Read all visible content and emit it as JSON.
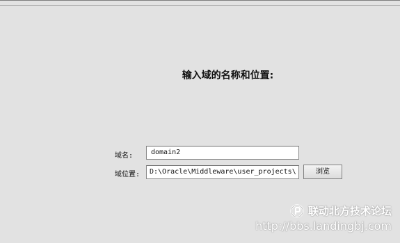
{
  "heading": "输入域的名称和位置:",
  "form": {
    "domain_name_label": "域名:",
    "domain_name_value": "domain2",
    "domain_location_label": "域位置:",
    "domain_location_value": "D:\\Oracle\\Middleware\\user_projects\\",
    "browse_button": "浏览"
  },
  "watermark": {
    "name": "联动北方技术论坛",
    "url": "http://bbs.landingbj.com"
  }
}
